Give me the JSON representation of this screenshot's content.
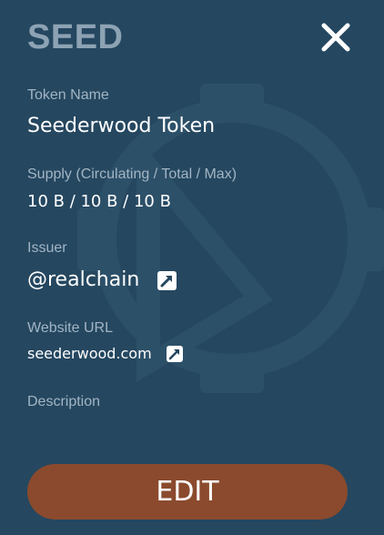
{
  "token": {
    "symbol": "SEED"
  },
  "fields": {
    "name": {
      "label": "Token Name",
      "value": "Seederwood Token"
    },
    "supply": {
      "label": "Supply (Circulating / Total / Max)",
      "value": "10 B / 10 B / 10 B"
    },
    "issuer": {
      "label": "Issuer",
      "value": "@realchain",
      "link_icon": "external-link-icon"
    },
    "website": {
      "label": "Website URL",
      "value": "seederwood.com",
      "link_icon": "external-link-icon"
    },
    "description": {
      "label": "Description",
      "value": ""
    }
  },
  "actions": {
    "close_icon": "close-icon",
    "edit_label": "EDIT"
  },
  "colors": {
    "panel_background": "#254760",
    "symbol_text": "#8da3b4",
    "label_text": "#a2b5c3",
    "value_text": "#ffffff",
    "edit_button": "#8b4a2d"
  }
}
